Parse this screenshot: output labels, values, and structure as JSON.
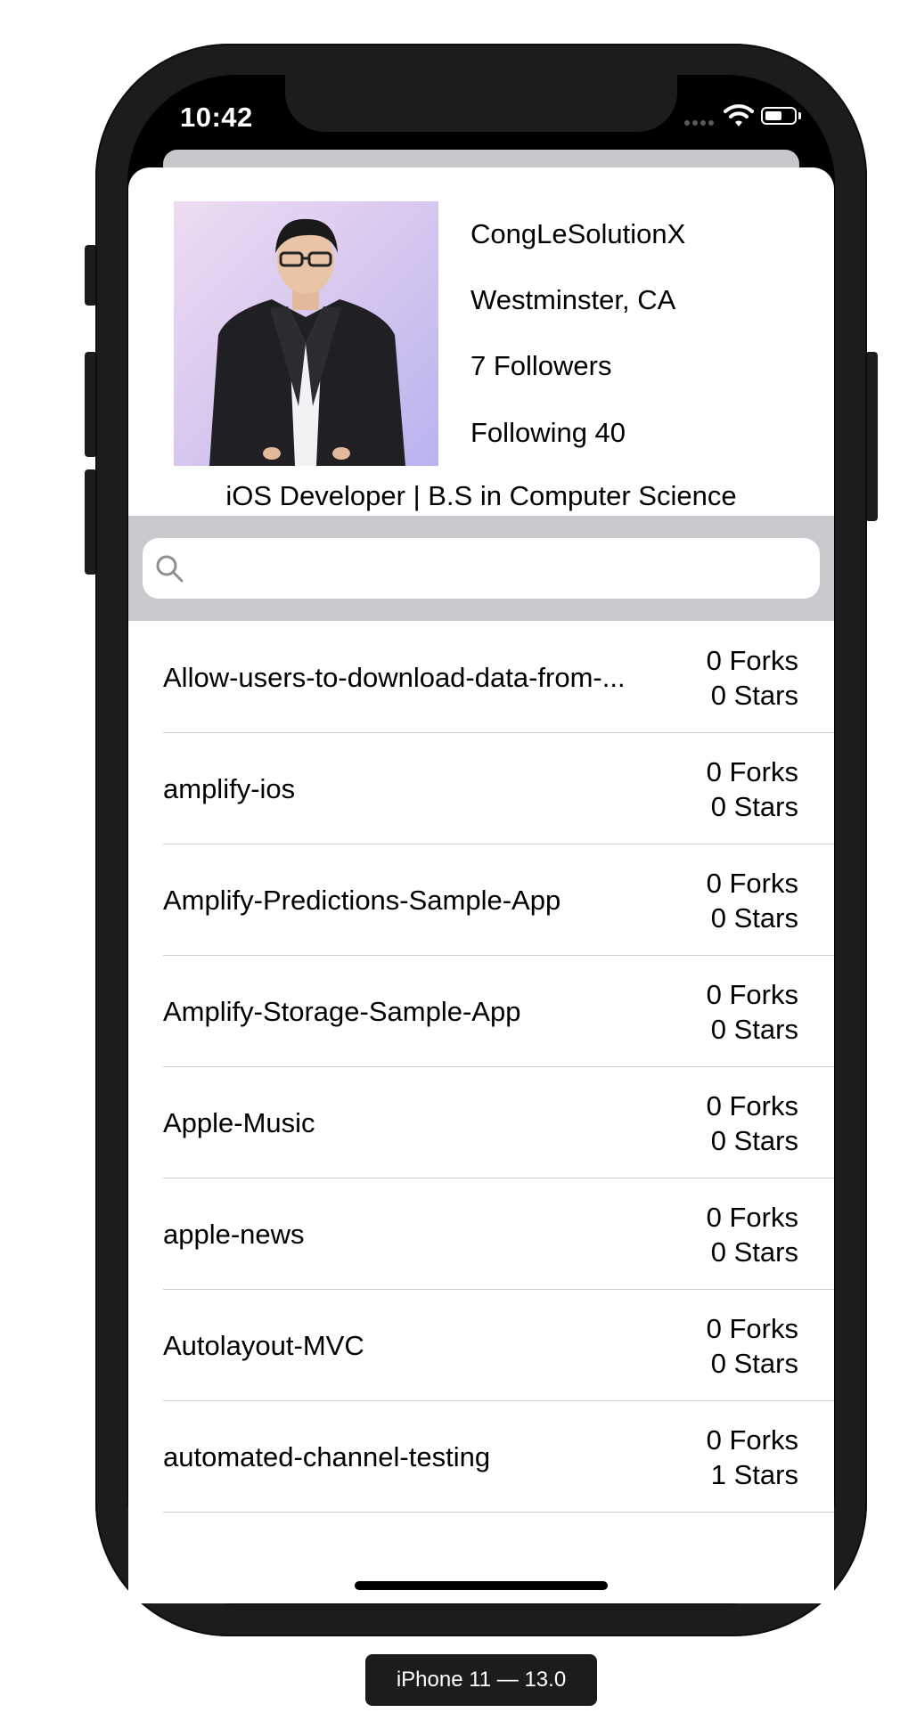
{
  "status_bar": {
    "time": "10:42",
    "battery_level": 0.6
  },
  "profile": {
    "username": "CongLeSolutionX",
    "location": "Westminster, CA",
    "followers": "7 Followers",
    "following": "Following 40",
    "bio": "iOS Developer | B.S in Computer Science"
  },
  "search": {
    "value": "",
    "placeholder": ""
  },
  "repos": [
    {
      "name": "Allow-users-to-download-data-from-...",
      "forks": "0 Forks",
      "stars": "0 Stars"
    },
    {
      "name": "amplify-ios",
      "forks": "0 Forks",
      "stars": "0 Stars"
    },
    {
      "name": "Amplify-Predictions-Sample-App",
      "forks": "0 Forks",
      "stars": "0 Stars"
    },
    {
      "name": "Amplify-Storage-Sample-App",
      "forks": "0 Forks",
      "stars": "0 Stars"
    },
    {
      "name": "Apple-Music",
      "forks": "0 Forks",
      "stars": "0 Stars"
    },
    {
      "name": "apple-news",
      "forks": "0 Forks",
      "stars": "0 Stars"
    },
    {
      "name": "Autolayout-MVC",
      "forks": "0 Forks",
      "stars": "0 Stars"
    },
    {
      "name": "automated-channel-testing",
      "forks": "0 Forks",
      "stars": "1 Stars"
    }
  ],
  "device_label": "iPhone 11 — 13.0",
  "colors": {
    "frame": "#1c1c1e",
    "search_bar": "#c9c9ce",
    "separator": "#d0d0d4"
  }
}
